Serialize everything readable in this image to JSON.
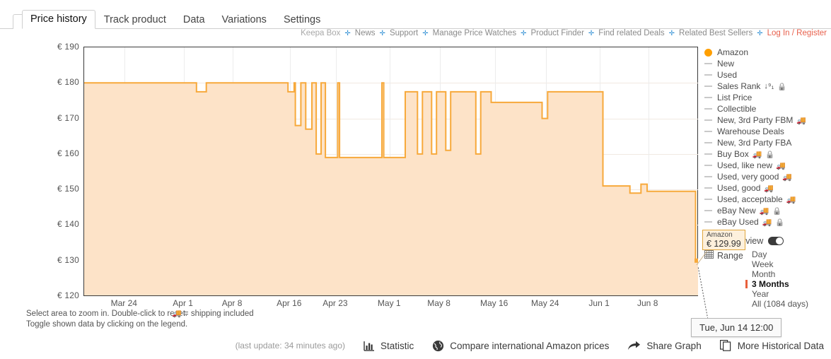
{
  "tabs": [
    {
      "label": "Price history",
      "active": true
    },
    {
      "label": "Track product",
      "active": false
    },
    {
      "label": "Data",
      "active": false
    },
    {
      "label": "Variations",
      "active": false
    },
    {
      "label": "Settings",
      "active": false
    }
  ],
  "linkbar": {
    "brand": "Keepa Box",
    "links": [
      "News",
      "Support",
      "Manage Price Watches",
      "Product Finder",
      "Find related Deals",
      "Related Best Sellers"
    ],
    "login": "Log In / Register",
    "separator": "✛"
  },
  "legend": {
    "items": [
      {
        "label": "Amazon",
        "marker": "dot",
        "color": "#ff9f00",
        "shipping": false,
        "locked": false,
        "extra": ""
      },
      {
        "label": "New",
        "marker": "dash",
        "shipping": false,
        "locked": false,
        "extra": ""
      },
      {
        "label": "Used",
        "marker": "dash",
        "shipping": false,
        "locked": false,
        "extra": ""
      },
      {
        "label": "Sales Rank",
        "marker": "dash",
        "shipping": false,
        "locked": true,
        "extra": "↓⁹₁"
      },
      {
        "label": "List Price",
        "marker": "dash",
        "shipping": false,
        "locked": false,
        "extra": ""
      },
      {
        "label": "Collectible",
        "marker": "dash",
        "shipping": false,
        "locked": false,
        "extra": ""
      },
      {
        "label": "New, 3rd Party FBM",
        "marker": "dash",
        "shipping": true,
        "locked": false,
        "extra": ""
      },
      {
        "label": "Warehouse Deals",
        "marker": "dash",
        "shipping": false,
        "locked": false,
        "extra": ""
      },
      {
        "label": "New, 3rd Party FBA",
        "marker": "dash",
        "shipping": false,
        "locked": false,
        "extra": ""
      },
      {
        "label": "Buy Box",
        "marker": "dash",
        "shipping": true,
        "locked": true,
        "extra": ""
      },
      {
        "label": "Used, like new",
        "marker": "dash",
        "shipping": true,
        "locked": false,
        "extra": ""
      },
      {
        "label": "Used, very good",
        "marker": "dash",
        "shipping": true,
        "locked": false,
        "extra": ""
      },
      {
        "label": "Used, good",
        "marker": "dash",
        "shipping": true,
        "locked": false,
        "extra": ""
      },
      {
        "label": "Used, acceptable",
        "marker": "dash",
        "shipping": true,
        "locked": false,
        "extra": ""
      },
      {
        "label": "eBay New",
        "marker": "dash",
        "shipping": true,
        "locked": true,
        "extra": ""
      },
      {
        "label": "eBay Used",
        "marker": "dash",
        "shipping": true,
        "locked": true,
        "extra": ""
      }
    ]
  },
  "group_view": {
    "label": "Group view",
    "enabled": true
  },
  "range": {
    "label": "Range",
    "options": [
      "Day",
      "Week",
      "Month",
      "3 Months",
      "Year",
      "All (1084 days)"
    ],
    "selected": "3 Months"
  },
  "tooltips": {
    "price": {
      "series": "Amazon",
      "value": "€ 129.99"
    },
    "date": "Tue, Jun 14 12:00"
  },
  "hints": {
    "line1": "Select area to zoom in. Double-click to reset.",
    "line2": "Toggle shown data by clicking on the legend.",
    "shipping": "= shipping included"
  },
  "footer": {
    "last_update": "(last update: 34 minutes ago)",
    "statistic": "Statistic",
    "compare": "Compare international Amazon prices",
    "share": "Share Graph",
    "more_data": "More Historical Data"
  },
  "chart_data": {
    "type": "area",
    "title": "",
    "xlabel": "",
    "ylabel": "",
    "currency": "€",
    "series_name": "Amazon",
    "line_color": "#f7a93b",
    "fill_color": "#fde3c8",
    "ylim": [
      120,
      190
    ],
    "yticks": [
      190,
      180,
      170,
      160,
      150,
      140,
      130,
      120
    ],
    "ytick_labels": [
      "€ 190",
      "€ 180",
      "€ 170",
      "€ 160",
      "€ 150",
      "€ 140",
      "€ 130",
      "€ 120"
    ],
    "xticks": [
      "Mar 24",
      "Apr 1",
      "Apr 8",
      "Apr 16",
      "Apr 23",
      "May 1",
      "May 8",
      "May 16",
      "May 24",
      "Jun 1",
      "Jun 8"
    ],
    "xtick_positions_pct": [
      6.6,
      16.2,
      24.2,
      33.5,
      41.0,
      49.8,
      57.9,
      66.9,
      75.2,
      84.0,
      91.9
    ],
    "grid": true,
    "current_value": 129.99,
    "steps": [
      {
        "x_pct": 0.0,
        "price": 180.0
      },
      {
        "x_pct": 18.0,
        "price": 180.0
      },
      {
        "x_pct": 18.3,
        "price": 177.5
      },
      {
        "x_pct": 19.6,
        "price": 177.5
      },
      {
        "x_pct": 19.9,
        "price": 180.0
      },
      {
        "x_pct": 32.9,
        "price": 180.0
      },
      {
        "x_pct": 33.2,
        "price": 177.5
      },
      {
        "x_pct": 33.9,
        "price": 177.5
      },
      {
        "x_pct": 34.2,
        "price": 180.0
      },
      {
        "x_pct": 34.4,
        "price": 168.0
      },
      {
        "x_pct": 35.0,
        "price": 168.0
      },
      {
        "x_pct": 35.3,
        "price": 180.0
      },
      {
        "x_pct": 35.8,
        "price": 180.0
      },
      {
        "x_pct": 36.1,
        "price": 167.0
      },
      {
        "x_pct": 36.8,
        "price": 167.0
      },
      {
        "x_pct": 37.1,
        "price": 180.0
      },
      {
        "x_pct": 37.5,
        "price": 180.0
      },
      {
        "x_pct": 37.8,
        "price": 160.0
      },
      {
        "x_pct": 38.3,
        "price": 160.0
      },
      {
        "x_pct": 38.6,
        "price": 180.0
      },
      {
        "x_pct": 39.0,
        "price": 180.0
      },
      {
        "x_pct": 39.3,
        "price": 159.0
      },
      {
        "x_pct": 41.0,
        "price": 159.0
      },
      {
        "x_pct": 41.3,
        "price": 180.0
      },
      {
        "x_pct": 41.6,
        "price": 159.0
      },
      {
        "x_pct": 48.2,
        "price": 159.0
      },
      {
        "x_pct": 48.5,
        "price": 180.0
      },
      {
        "x_pct": 48.8,
        "price": 159.0
      },
      {
        "x_pct": 52.0,
        "price": 159.0
      },
      {
        "x_pct": 52.3,
        "price": 177.5
      },
      {
        "x_pct": 54.0,
        "price": 177.5
      },
      {
        "x_pct": 54.3,
        "price": 160.0
      },
      {
        "x_pct": 54.8,
        "price": 160.0
      },
      {
        "x_pct": 55.1,
        "price": 177.5
      },
      {
        "x_pct": 56.3,
        "price": 177.5
      },
      {
        "x_pct": 56.6,
        "price": 160.0
      },
      {
        "x_pct": 57.1,
        "price": 160.0
      },
      {
        "x_pct": 57.4,
        "price": 177.5
      },
      {
        "x_pct": 58.6,
        "price": 177.5
      },
      {
        "x_pct": 58.9,
        "price": 161.0
      },
      {
        "x_pct": 59.4,
        "price": 161.0
      },
      {
        "x_pct": 59.7,
        "price": 177.5
      },
      {
        "x_pct": 63.5,
        "price": 177.5
      },
      {
        "x_pct": 63.8,
        "price": 160.0
      },
      {
        "x_pct": 64.3,
        "price": 160.0
      },
      {
        "x_pct": 64.6,
        "price": 177.5
      },
      {
        "x_pct": 66.0,
        "price": 177.5
      },
      {
        "x_pct": 66.3,
        "price": 174.5
      },
      {
        "x_pct": 74.3,
        "price": 174.5
      },
      {
        "x_pct": 74.6,
        "price": 170.0
      },
      {
        "x_pct": 75.2,
        "price": 170.0
      },
      {
        "x_pct": 75.5,
        "price": 177.5
      },
      {
        "x_pct": 84.2,
        "price": 177.5
      },
      {
        "x_pct": 84.5,
        "price": 151.0
      },
      {
        "x_pct": 88.6,
        "price": 151.0
      },
      {
        "x_pct": 88.9,
        "price": 149.0
      },
      {
        "x_pct": 90.4,
        "price": 149.0
      },
      {
        "x_pct": 90.7,
        "price": 151.5
      },
      {
        "x_pct": 91.4,
        "price": 151.5
      },
      {
        "x_pct": 91.7,
        "price": 149.5
      },
      {
        "x_pct": 99.3,
        "price": 149.5
      },
      {
        "x_pct": 99.6,
        "price": 129.99
      },
      {
        "x_pct": 100.0,
        "price": 129.99
      }
    ]
  }
}
